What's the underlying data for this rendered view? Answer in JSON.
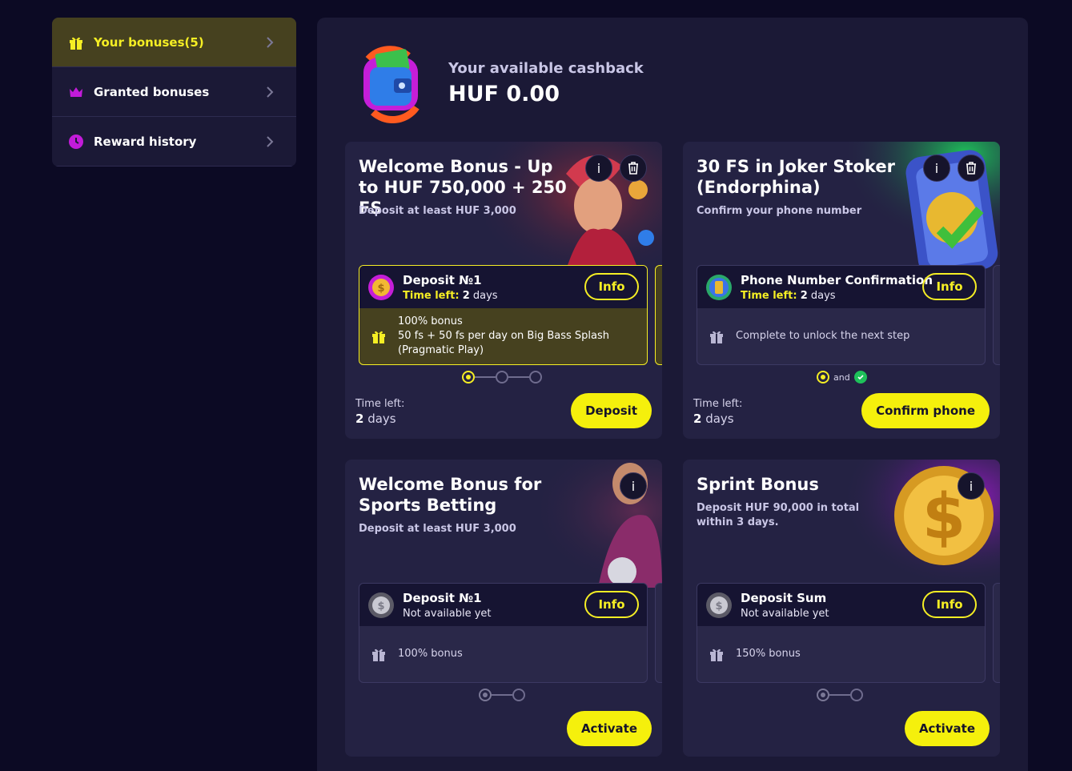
{
  "sidebar": {
    "items": [
      {
        "label": "Your bonuses",
        "count": "(5)"
      },
      {
        "label": "Granted bonuses"
      },
      {
        "label": "Reward history"
      }
    ]
  },
  "cashback": {
    "label": "Your available cashback",
    "value": "HUF 0.00"
  },
  "cards": [
    {
      "title": "Welcome Bonus - Up to HUF 750,000 + 250 FS",
      "subtitle": "Deposit at least HUF 3,000",
      "step": {
        "name": "Deposit №1",
        "time_label": "Time left:",
        "time_num": "2",
        "time_unit": "days",
        "info": "Info",
        "body_lines": [
          "100% bonus",
          "50 fs + 50 fs per day on Big Bass Splash",
          "(Pragmatic Play)"
        ]
      },
      "time_left_label": "Time left:",
      "time_left_num": "2",
      "time_left_unit": "days",
      "action": "Deposit"
    },
    {
      "title": "30 FS in Joker Stoker (Endorphina)",
      "subtitle": "Confirm your phone number",
      "step": {
        "name": "Phone Number Confirmation",
        "time_label": "Time left:",
        "time_num": "2",
        "time_unit": "days",
        "info": "Info",
        "body": "Complete to unlock the next step"
      },
      "and_label": "and",
      "time_left_label": "Time left:",
      "time_left_num": "2",
      "time_left_unit": "days",
      "action": "Confirm phone"
    },
    {
      "title": "Welcome Bonus for Sports Betting",
      "subtitle": "Deposit at least HUF 3,000",
      "step": {
        "name": "Deposit №1",
        "status": "Not available yet",
        "info": "Info",
        "body": "100% bonus"
      },
      "action": "Activate"
    },
    {
      "title": "Sprint Bonus",
      "subtitle": "Deposit HUF 90,000 in total within 3 days.",
      "step": {
        "name": "Deposit Sum",
        "status": "Not available yet",
        "info": "Info",
        "body": "150% bonus"
      },
      "action": "Activate"
    }
  ],
  "icons": {
    "info": "i",
    "accent": "#f5f00c",
    "active_bg": "#46411f"
  }
}
